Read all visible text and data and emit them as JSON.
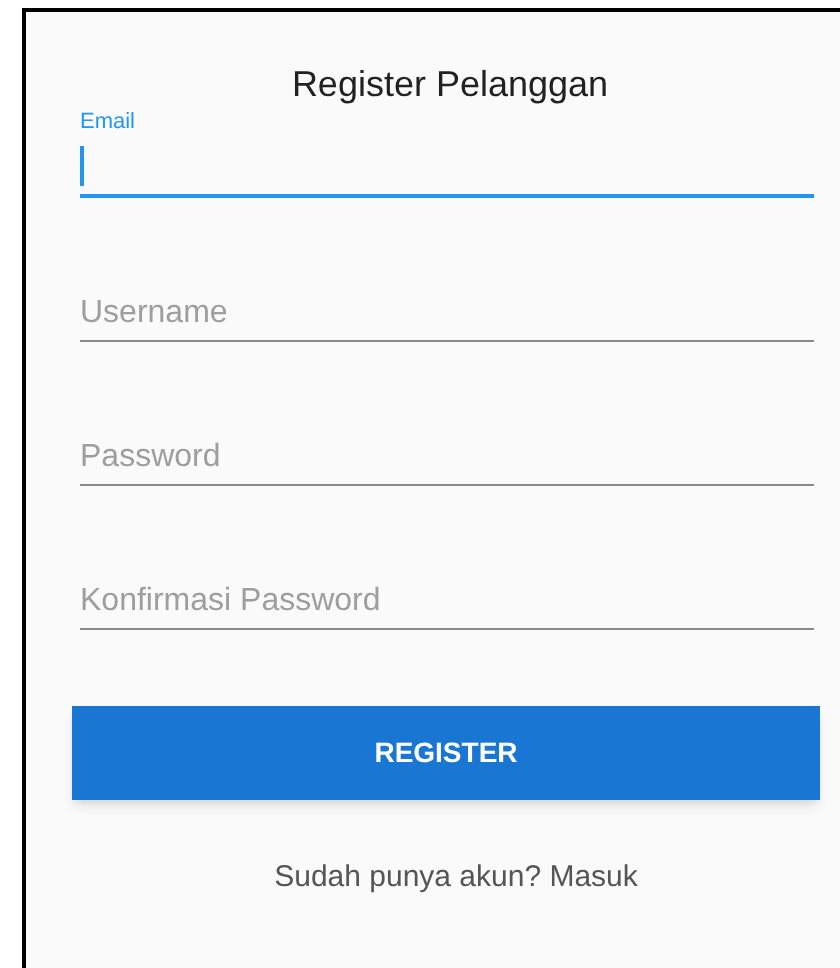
{
  "title": "Register Pelanggan",
  "fields": [
    {
      "label": "Email",
      "focused": true
    },
    {
      "label": "Username",
      "focused": false
    },
    {
      "label": "Password",
      "focused": false
    },
    {
      "label": "Konfirmasi Password",
      "focused": false
    }
  ],
  "register_button": "REGISTER",
  "login_link": "Sudah punya akun? Masuk"
}
